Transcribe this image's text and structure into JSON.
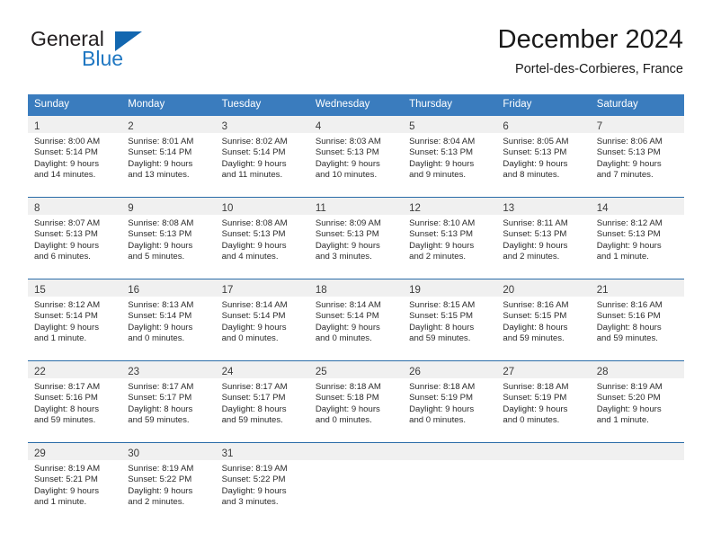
{
  "brand": {
    "name_top": "General",
    "name_bottom": "Blue",
    "accent_color": "#1267b0"
  },
  "header": {
    "month_title": "December 2024",
    "location": "Portel-des-Corbieres, France"
  },
  "theme": {
    "header_blue": "#3a7cbe",
    "row_border_blue": "#2a6ca8",
    "day_band_gray": "#f0f0f0"
  },
  "weekdays": [
    "Sunday",
    "Monday",
    "Tuesday",
    "Wednesday",
    "Thursday",
    "Friday",
    "Saturday"
  ],
  "weeks": [
    [
      {
        "day": "1",
        "sunrise": "Sunrise: 8:00 AM",
        "sunset": "Sunset: 5:14 PM",
        "daylight1": "Daylight: 9 hours",
        "daylight2": "and 14 minutes."
      },
      {
        "day": "2",
        "sunrise": "Sunrise: 8:01 AM",
        "sunset": "Sunset: 5:14 PM",
        "daylight1": "Daylight: 9 hours",
        "daylight2": "and 13 minutes."
      },
      {
        "day": "3",
        "sunrise": "Sunrise: 8:02 AM",
        "sunset": "Sunset: 5:14 PM",
        "daylight1": "Daylight: 9 hours",
        "daylight2": "and 11 minutes."
      },
      {
        "day": "4",
        "sunrise": "Sunrise: 8:03 AM",
        "sunset": "Sunset: 5:13 PM",
        "daylight1": "Daylight: 9 hours",
        "daylight2": "and 10 minutes."
      },
      {
        "day": "5",
        "sunrise": "Sunrise: 8:04 AM",
        "sunset": "Sunset: 5:13 PM",
        "daylight1": "Daylight: 9 hours",
        "daylight2": "and 9 minutes."
      },
      {
        "day": "6",
        "sunrise": "Sunrise: 8:05 AM",
        "sunset": "Sunset: 5:13 PM",
        "daylight1": "Daylight: 9 hours",
        "daylight2": "and 8 minutes."
      },
      {
        "day": "7",
        "sunrise": "Sunrise: 8:06 AM",
        "sunset": "Sunset: 5:13 PM",
        "daylight1": "Daylight: 9 hours",
        "daylight2": "and 7 minutes."
      }
    ],
    [
      {
        "day": "8",
        "sunrise": "Sunrise: 8:07 AM",
        "sunset": "Sunset: 5:13 PM",
        "daylight1": "Daylight: 9 hours",
        "daylight2": "and 6 minutes."
      },
      {
        "day": "9",
        "sunrise": "Sunrise: 8:08 AM",
        "sunset": "Sunset: 5:13 PM",
        "daylight1": "Daylight: 9 hours",
        "daylight2": "and 5 minutes."
      },
      {
        "day": "10",
        "sunrise": "Sunrise: 8:08 AM",
        "sunset": "Sunset: 5:13 PM",
        "daylight1": "Daylight: 9 hours",
        "daylight2": "and 4 minutes."
      },
      {
        "day": "11",
        "sunrise": "Sunrise: 8:09 AM",
        "sunset": "Sunset: 5:13 PM",
        "daylight1": "Daylight: 9 hours",
        "daylight2": "and 3 minutes."
      },
      {
        "day": "12",
        "sunrise": "Sunrise: 8:10 AM",
        "sunset": "Sunset: 5:13 PM",
        "daylight1": "Daylight: 9 hours",
        "daylight2": "and 2 minutes."
      },
      {
        "day": "13",
        "sunrise": "Sunrise: 8:11 AM",
        "sunset": "Sunset: 5:13 PM",
        "daylight1": "Daylight: 9 hours",
        "daylight2": "and 2 minutes."
      },
      {
        "day": "14",
        "sunrise": "Sunrise: 8:12 AM",
        "sunset": "Sunset: 5:13 PM",
        "daylight1": "Daylight: 9 hours",
        "daylight2": "and 1 minute."
      }
    ],
    [
      {
        "day": "15",
        "sunrise": "Sunrise: 8:12 AM",
        "sunset": "Sunset: 5:14 PM",
        "daylight1": "Daylight: 9 hours",
        "daylight2": "and 1 minute."
      },
      {
        "day": "16",
        "sunrise": "Sunrise: 8:13 AM",
        "sunset": "Sunset: 5:14 PM",
        "daylight1": "Daylight: 9 hours",
        "daylight2": "and 0 minutes."
      },
      {
        "day": "17",
        "sunrise": "Sunrise: 8:14 AM",
        "sunset": "Sunset: 5:14 PM",
        "daylight1": "Daylight: 9 hours",
        "daylight2": "and 0 minutes."
      },
      {
        "day": "18",
        "sunrise": "Sunrise: 8:14 AM",
        "sunset": "Sunset: 5:14 PM",
        "daylight1": "Daylight: 9 hours",
        "daylight2": "and 0 minutes."
      },
      {
        "day": "19",
        "sunrise": "Sunrise: 8:15 AM",
        "sunset": "Sunset: 5:15 PM",
        "daylight1": "Daylight: 8 hours",
        "daylight2": "and 59 minutes."
      },
      {
        "day": "20",
        "sunrise": "Sunrise: 8:16 AM",
        "sunset": "Sunset: 5:15 PM",
        "daylight1": "Daylight: 8 hours",
        "daylight2": "and 59 minutes."
      },
      {
        "day": "21",
        "sunrise": "Sunrise: 8:16 AM",
        "sunset": "Sunset: 5:16 PM",
        "daylight1": "Daylight: 8 hours",
        "daylight2": "and 59 minutes."
      }
    ],
    [
      {
        "day": "22",
        "sunrise": "Sunrise: 8:17 AM",
        "sunset": "Sunset: 5:16 PM",
        "daylight1": "Daylight: 8 hours",
        "daylight2": "and 59 minutes."
      },
      {
        "day": "23",
        "sunrise": "Sunrise: 8:17 AM",
        "sunset": "Sunset: 5:17 PM",
        "daylight1": "Daylight: 8 hours",
        "daylight2": "and 59 minutes."
      },
      {
        "day": "24",
        "sunrise": "Sunrise: 8:17 AM",
        "sunset": "Sunset: 5:17 PM",
        "daylight1": "Daylight: 8 hours",
        "daylight2": "and 59 minutes."
      },
      {
        "day": "25",
        "sunrise": "Sunrise: 8:18 AM",
        "sunset": "Sunset: 5:18 PM",
        "daylight1": "Daylight: 9 hours",
        "daylight2": "and 0 minutes."
      },
      {
        "day": "26",
        "sunrise": "Sunrise: 8:18 AM",
        "sunset": "Sunset: 5:19 PM",
        "daylight1": "Daylight: 9 hours",
        "daylight2": "and 0 minutes."
      },
      {
        "day": "27",
        "sunrise": "Sunrise: 8:18 AM",
        "sunset": "Sunset: 5:19 PM",
        "daylight1": "Daylight: 9 hours",
        "daylight2": "and 0 minutes."
      },
      {
        "day": "28",
        "sunrise": "Sunrise: 8:19 AM",
        "sunset": "Sunset: 5:20 PM",
        "daylight1": "Daylight: 9 hours",
        "daylight2": "and 1 minute."
      }
    ],
    [
      {
        "day": "29",
        "sunrise": "Sunrise: 8:19 AM",
        "sunset": "Sunset: 5:21 PM",
        "daylight1": "Daylight: 9 hours",
        "daylight2": "and 1 minute."
      },
      {
        "day": "30",
        "sunrise": "Sunrise: 8:19 AM",
        "sunset": "Sunset: 5:22 PM",
        "daylight1": "Daylight: 9 hours",
        "daylight2": "and 2 minutes."
      },
      {
        "day": "31",
        "sunrise": "Sunrise: 8:19 AM",
        "sunset": "Sunset: 5:22 PM",
        "daylight1": "Daylight: 9 hours",
        "daylight2": "and 3 minutes."
      },
      {
        "day": "",
        "sunrise": "",
        "sunset": "",
        "daylight1": "",
        "daylight2": ""
      },
      {
        "day": "",
        "sunrise": "",
        "sunset": "",
        "daylight1": "",
        "daylight2": ""
      },
      {
        "day": "",
        "sunrise": "",
        "sunset": "",
        "daylight1": "",
        "daylight2": ""
      },
      {
        "day": "",
        "sunrise": "",
        "sunset": "",
        "daylight1": "",
        "daylight2": ""
      }
    ]
  ]
}
